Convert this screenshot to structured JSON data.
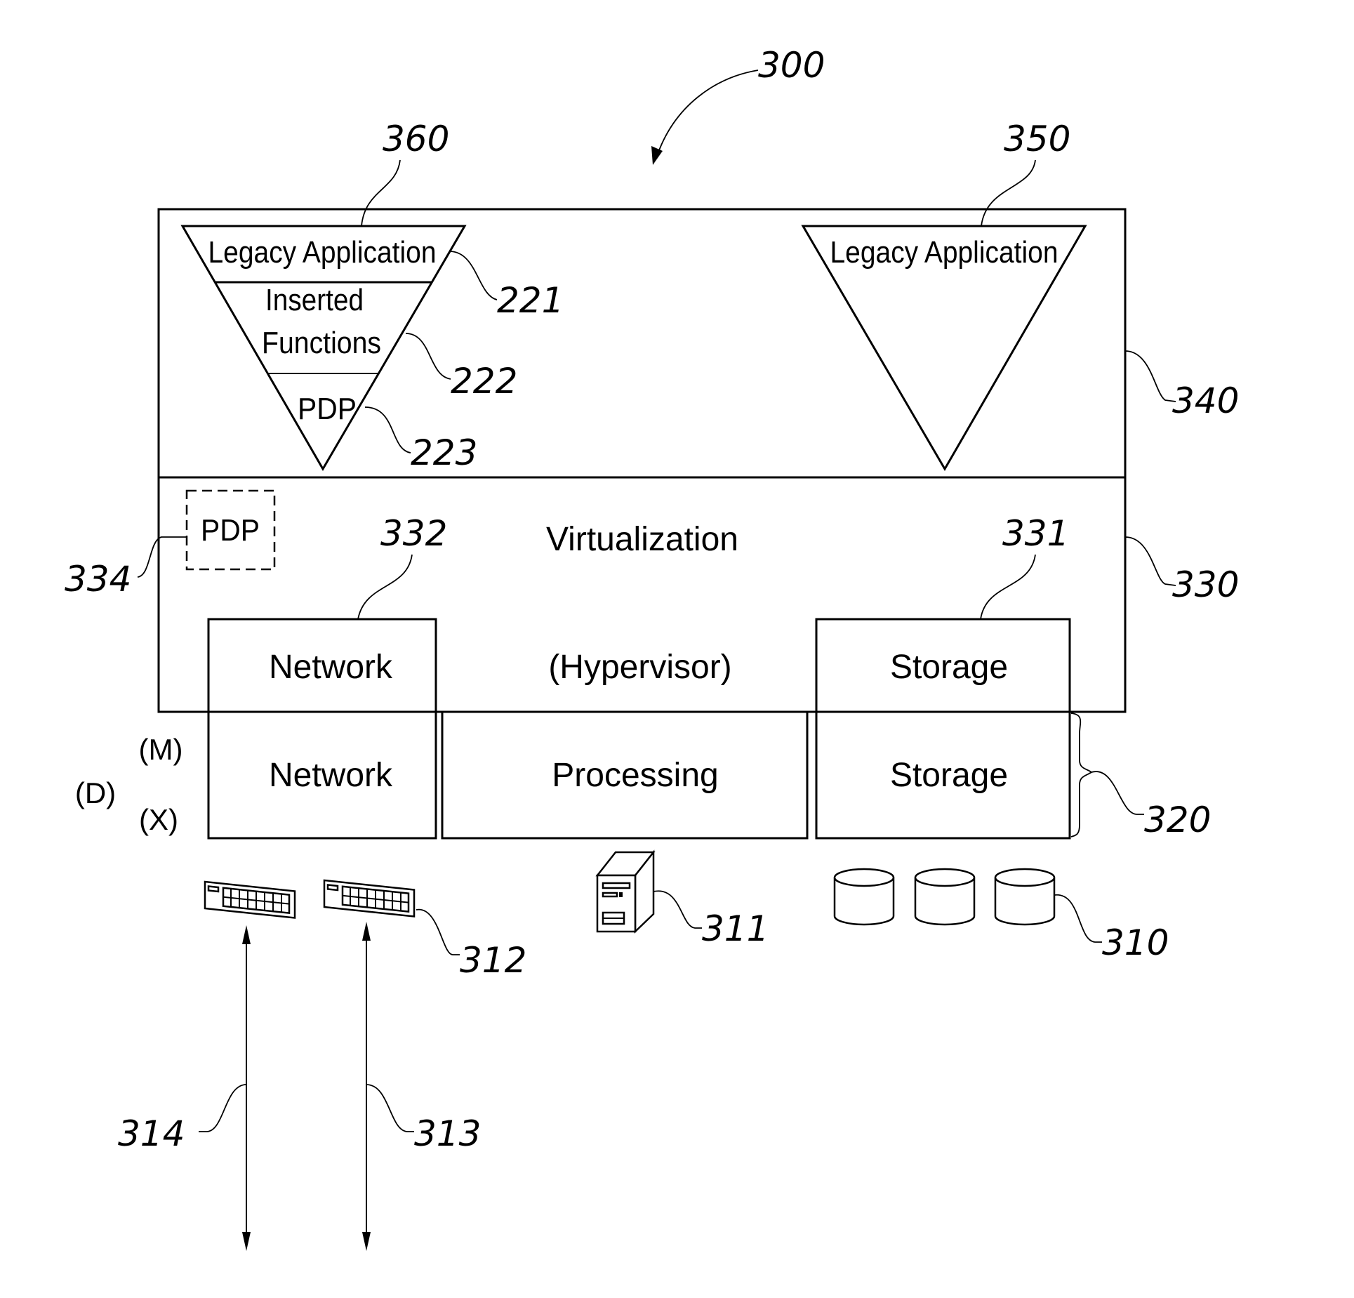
{
  "figure": {
    "ref": "300",
    "application_layer": {
      "ref": "340",
      "modified_app": {
        "ref": "360",
        "sections": [
          {
            "label": "Legacy Application",
            "ref": "221"
          },
          {
            "label_lines": [
              "Inserted",
              "Functions"
            ],
            "ref": "222"
          },
          {
            "label": "PDP",
            "ref": "223"
          }
        ]
      },
      "legacy_app": {
        "ref": "350",
        "label": "Legacy Application"
      }
    },
    "virtualization_layer": {
      "ref": "330",
      "title": "Virtualization",
      "subtitle": "(Hypervisor)",
      "pdp": {
        "label": "PDP",
        "ref": "334"
      },
      "network": {
        "label": "Network",
        "ref": "332"
      },
      "storage": {
        "label": "Storage",
        "ref": "331"
      }
    },
    "physical_layer": {
      "ref": "320",
      "row_labels": [
        "(M)",
        "(D)",
        "(X)"
      ],
      "blocks": [
        {
          "label": "Network"
        },
        {
          "label": "Processing"
        },
        {
          "label": "Storage"
        }
      ]
    },
    "hardware": {
      "disks": {
        "ref": "310",
        "count": 3
      },
      "server": {
        "ref": "311"
      },
      "switches": {
        "ref": "312",
        "count": 2
      },
      "link_a": {
        "ref": "313"
      },
      "link_b": {
        "ref": "314"
      }
    }
  }
}
